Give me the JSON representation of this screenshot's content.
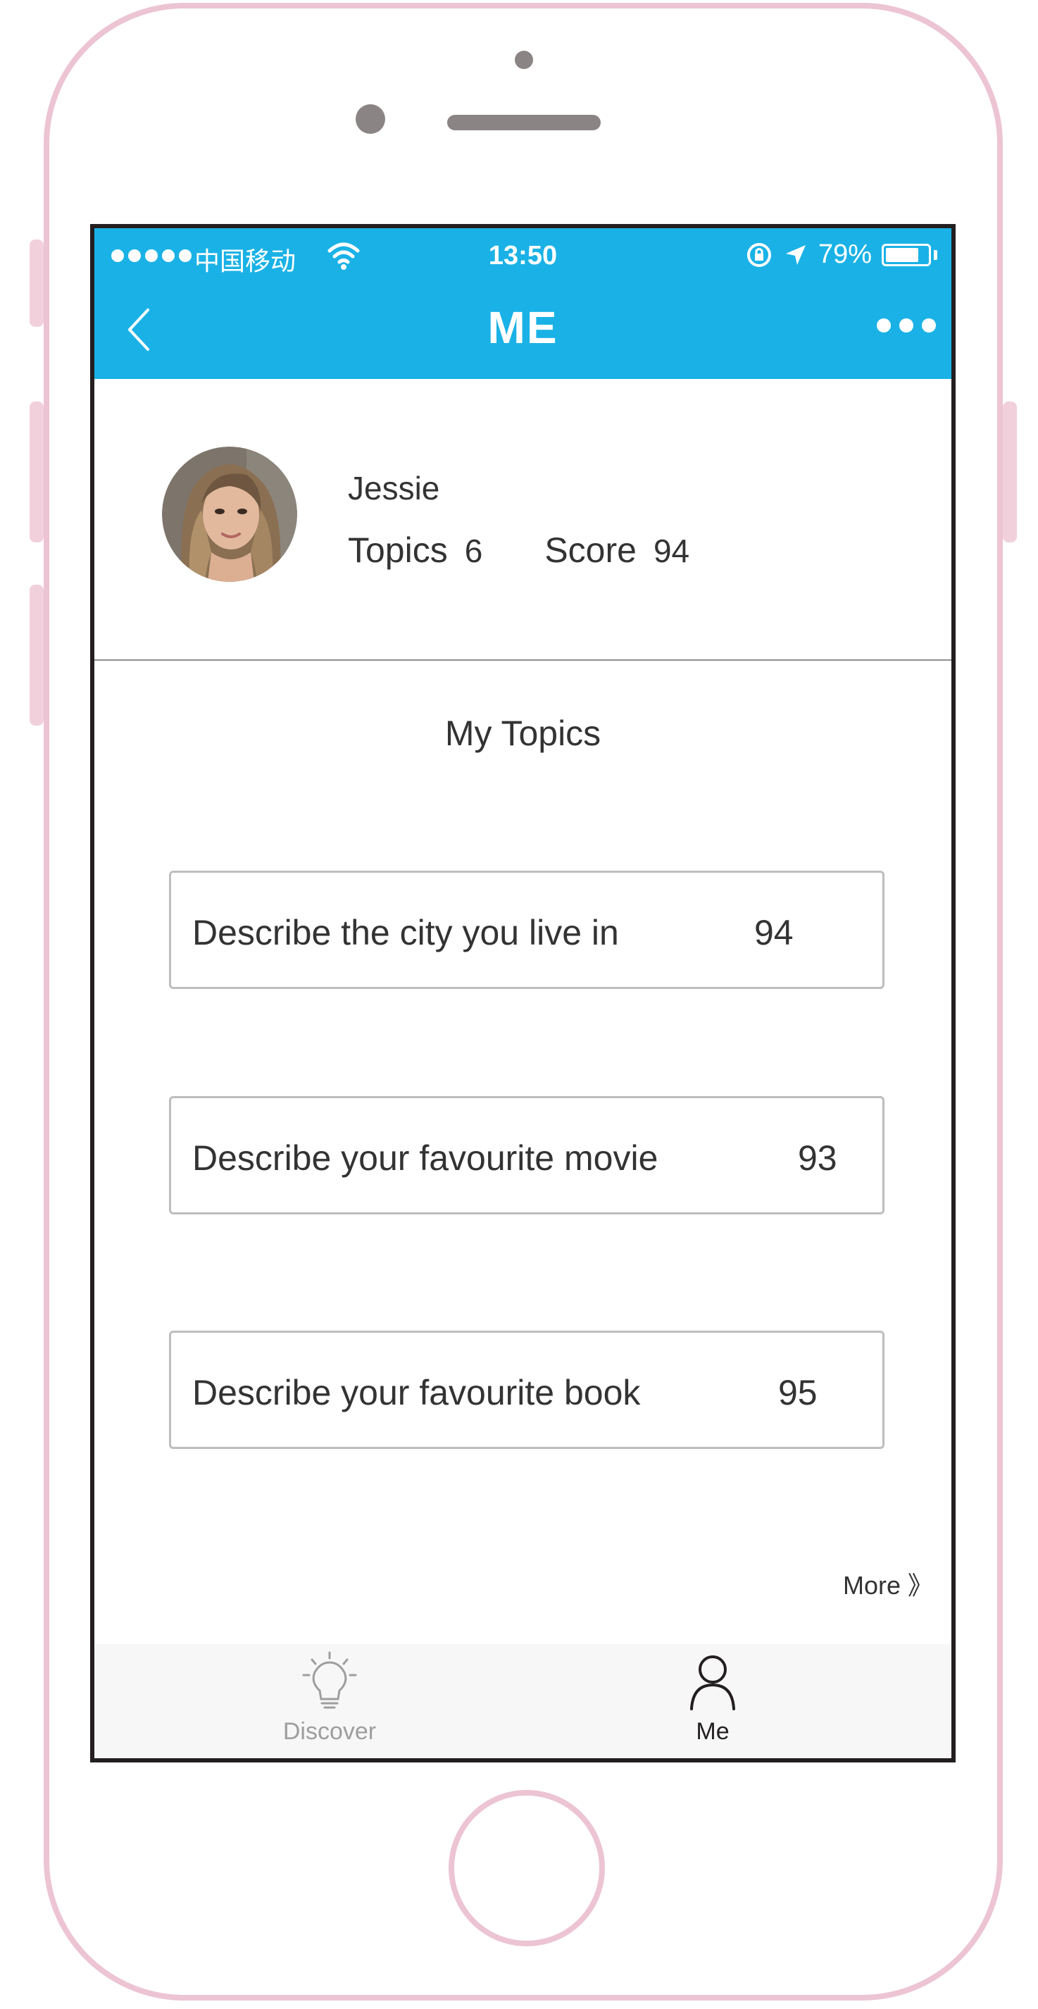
{
  "status_bar": {
    "carrier": "中国移动",
    "time": "13:50",
    "battery": "79%",
    "battery_level": 0.79
  },
  "nav": {
    "title": "ME"
  },
  "profile": {
    "name": "Jessie",
    "topics_label": "Topics",
    "topics_count": "6",
    "score_label": "Score",
    "score_value": "94"
  },
  "section": {
    "title": "My Topics"
  },
  "topics": [
    {
      "name": "Describe the city you live in",
      "score": "94"
    },
    {
      "name": "Describe your favourite movie",
      "score": "93"
    },
    {
      "name": "Describe your favourite book",
      "score": "95"
    }
  ],
  "more_link": "More 》",
  "tabbar": {
    "items": [
      {
        "label": "Discover",
        "icon": "lightbulb-icon",
        "active": false
      },
      {
        "label": "Me",
        "icon": "person-icon",
        "active": true
      }
    ]
  },
  "colors": {
    "accent": "#1ab2e6",
    "frame": "#ecc4d3",
    "text": "#333333",
    "inactive_tab": "#9e9e9e"
  }
}
